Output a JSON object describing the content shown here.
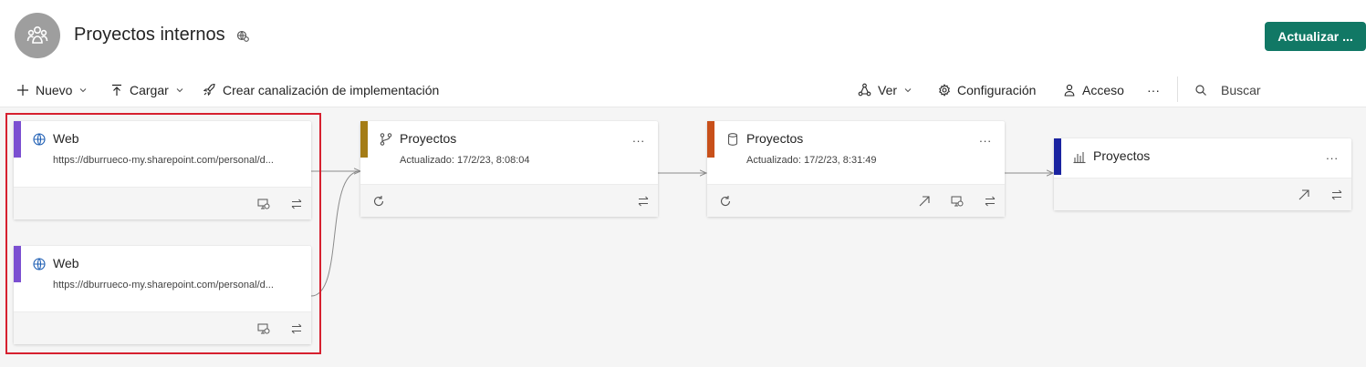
{
  "header": {
    "workspace_title": "Proyectos internos",
    "refresh_button_label": "Actualizar ..."
  },
  "toolbar": {
    "new_label": "Nuevo",
    "upload_label": "Cargar",
    "pipeline_label": "Crear canalización de implementación",
    "view_label": "Ver",
    "settings_label": "Configuración",
    "access_label": "Acceso",
    "more_label": "···",
    "search_label": "Buscar"
  },
  "lineage": {
    "sources": [
      {
        "title": "Web",
        "subtitle": "https://dburrueco-my.sharepoint.com/personal/d...",
        "icon": "globe-icon"
      },
      {
        "title": "Web",
        "subtitle": "https://dburrueco-my.sharepoint.com/personal/d...",
        "icon": "globe-icon"
      }
    ],
    "dataflow": {
      "title": "Proyectos",
      "subtitle": "Actualizado: 17/2/23, 8:08:04",
      "icon": "dataflow-icon",
      "accent": "#a47c16"
    },
    "dataset": {
      "title": "Proyectos",
      "subtitle": "Actualizado: 17/2/23, 8:31:49",
      "icon": "dataset-icon",
      "accent": "#c8501a"
    },
    "report": {
      "title": "Proyectos",
      "icon": "report-icon",
      "accent": "#1a23a0"
    },
    "source_accent": "#7b4fd1",
    "card_more_label": "..."
  },
  "colors": {
    "primary_button": "#117865",
    "selection_border": "#d6202f"
  }
}
